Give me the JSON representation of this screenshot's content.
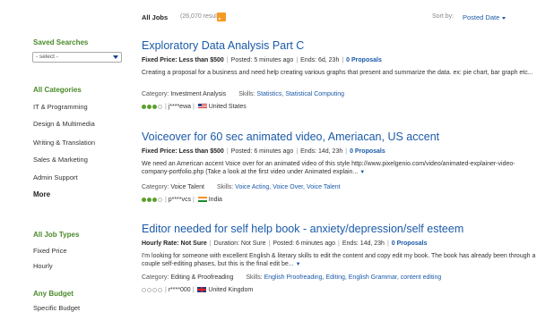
{
  "sidebar": {
    "saved_searches": {
      "heading": "Saved Searches",
      "select_value": "- select -"
    },
    "categories": {
      "heading": "All Categories",
      "items": [
        "IT & Programming",
        "Design & Multimedia",
        "Writing & Translation",
        "Sales & Marketing",
        "Admin Support"
      ],
      "more_label": "More"
    },
    "job_types": {
      "heading": "All Job Types",
      "items": [
        "Fixed Price",
        "Hourly"
      ]
    },
    "budget": {
      "heading": "Any Budget",
      "items": [
        "Specific Budget"
      ]
    }
  },
  "header": {
    "title": "All Jobs",
    "count": "(26,070 results)",
    "rss_icon": "rss-icon",
    "sort_label": "Sort by:",
    "sort_value": "Posted Date"
  },
  "jobs": [
    {
      "title": "Exploratory Data Analysis Part C",
      "type_label": "Fixed Price: Less than $500",
      "duration": "",
      "posted": "Posted: 5 minutes ago",
      "ends": "Ends: 6d, 23h",
      "proposals": "0 Proposals",
      "description": "Creating a proposal for a business and need help creating various graphs that present and summarize the data. ex: pie chart, bar graph etc...",
      "category_label": "Category:",
      "category": "Investment Analysis",
      "skills_label": "Skills:",
      "skills": "Statistics, Statistical Computing",
      "rating_filled": 3,
      "rating_total": 4,
      "client": "j****ewa",
      "country": "United States",
      "flag": "us"
    },
    {
      "title": "Voiceover for 60 sec animated video, Ameriacan, US accent",
      "type_label": "Fixed Price: Less than $500",
      "duration": "",
      "posted": "Posted: 6 minutes ago",
      "ends": "Ends: 14d, 23h",
      "proposals": "0 Proposals",
      "description": "We need an American accent Voice over for an animated video of this style http://www.pixelgenio.com/video/animated-explainer-video-company-portfolio.php (Take a look at the first video under Animated explain...",
      "category_label": "Category:",
      "category": "Voice Talent",
      "skills_label": "Skills:",
      "skills": "Voice Acting, Voice Over, Voice Talent",
      "rating_filled": 3,
      "rating_total": 4,
      "client": "p****vcs",
      "country": "India",
      "flag": "in"
    },
    {
      "title": "Editor needed for self help book - anxiety/depression/self esteem",
      "type_label": "Hourly Rate: Not Sure",
      "duration": "Duration: Not Sure",
      "posted": "Posted: 6 minutes ago",
      "ends": "Ends: 14d, 23h",
      "proposals": "0 Proposals",
      "description": "I'm looking for someone with excellent English & literary skills to edit the content and copy edit my book. The book has already been through a couple self-editing phases, but this is the final edit be...",
      "category_label": "Category:",
      "category": "Editing & Proofreading",
      "skills_label": "Skills:",
      "skills": "English Proofreading, Editing, English Grammar, content editing",
      "rating_filled": 0,
      "rating_total": 4,
      "client": "r****000",
      "country": "United Kingdom",
      "flag": "uk"
    }
  ],
  "colors": {
    "link": "#1a5aa8",
    "sidebar_heading": "#4a8a2a",
    "rating_on": "#5aa02c"
  }
}
